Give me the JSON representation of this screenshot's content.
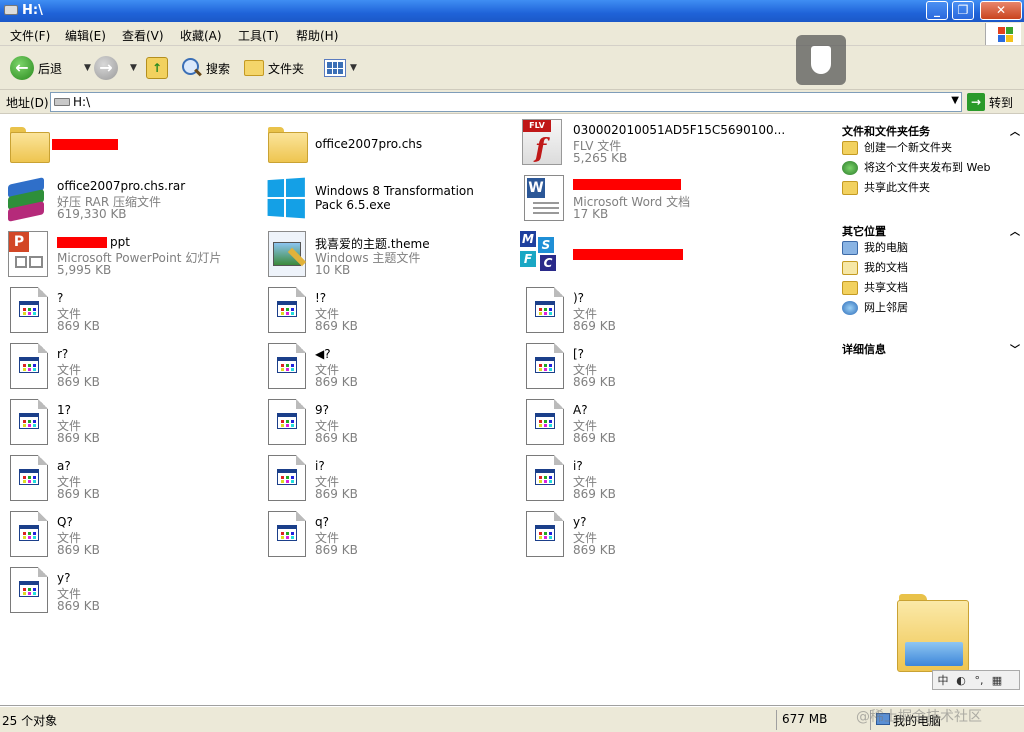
{
  "window": {
    "title": "H:\\"
  },
  "menu": [
    "文件(F)",
    "编辑(E)",
    "查看(V)",
    "收藏(A)",
    "工具(T)",
    "帮助(H)"
  ],
  "toolbar": {
    "back_label": "后退",
    "search_label": "搜索",
    "folders_label": "文件夹"
  },
  "address": {
    "label": "地址(D)",
    "value": "H:\\",
    "go_label": "转到"
  },
  "files": [
    {
      "name": "",
      "type": "",
      "size": "",
      "icon": "folder-icon",
      "redacted": true
    },
    {
      "name": "office2007pro.chs",
      "type": "",
      "size": "",
      "icon": "folder-icon"
    },
    {
      "name": "030002010051AD5F15C5690100...",
      "type": "FLV 文件",
      "size": "5,265 KB",
      "icon": "flv-icon"
    },
    {
      "name": "office2007pro.chs.rar",
      "type": "好压 RAR 压缩文件",
      "size": "619,330 KB",
      "icon": "rar-icon"
    },
    {
      "name": "Windows 8 Transformation Pack 6.5.exe",
      "type": "",
      "size": "",
      "icon": "windows8-icon"
    },
    {
      "name": "",
      "type": "Microsoft Word 文档",
      "size": "17 KB",
      "icon": "word-document-icon",
      "redacted": true
    },
    {
      "name": "ppt",
      "type": "Microsoft PowerPoint 幻灯片",
      "size": "5,995 KB",
      "icon": "powerpoint-icon",
      "redacted": true
    },
    {
      "name": "我喜爱的主题.theme",
      "type": "Windows 主题文件",
      "size": "10 KB",
      "icon": "theme-icon"
    },
    {
      "name": "",
      "type": "",
      "size": "",
      "icon": "msc-icon",
      "redacted": true
    },
    {
      "name": "?",
      "type": "文件",
      "size": "869 KB",
      "icon": "generic-file-icon"
    },
    {
      "name": "!?",
      "type": "文件",
      "size": "869 KB",
      "icon": "generic-file-icon"
    },
    {
      "name": ")?",
      "type": "文件",
      "size": "869 KB",
      "icon": "generic-file-icon"
    },
    {
      "name": "r?",
      "type": "文件",
      "size": "869 KB",
      "icon": "generic-file-icon"
    },
    {
      "name": "◀?",
      "type": "文件",
      "size": "869 KB",
      "icon": "generic-file-icon"
    },
    {
      "name": "[?",
      "type": "文件",
      "size": "869 KB",
      "icon": "generic-file-icon"
    },
    {
      "name": "1?",
      "type": "文件",
      "size": "869 KB",
      "icon": "generic-file-icon"
    },
    {
      "name": "9?",
      "type": "文件",
      "size": "869 KB",
      "icon": "generic-file-icon"
    },
    {
      "name": "A?",
      "type": "文件",
      "size": "869 KB",
      "icon": "generic-file-icon"
    },
    {
      "name": "a?",
      "type": "文件",
      "size": "869 KB",
      "icon": "generic-file-icon"
    },
    {
      "name": "i?",
      "type": "文件",
      "size": "869 KB",
      "icon": "generic-file-icon"
    },
    {
      "name": "i?",
      "type": "文件",
      "size": "869 KB",
      "icon": "generic-file-icon"
    },
    {
      "name": "Q?",
      "type": "文件",
      "size": "869 KB",
      "icon": "generic-file-icon"
    },
    {
      "name": "q?",
      "type": "文件",
      "size": "869 KB",
      "icon": "generic-file-icon"
    },
    {
      "name": "y?",
      "type": "文件",
      "size": "869 KB",
      "icon": "generic-file-icon"
    },
    {
      "name": "y?",
      "type": "文件",
      "size": "869 KB",
      "icon": "generic-file-icon"
    }
  ],
  "taskpane": {
    "tasks": {
      "title": "文件和文件夹任务",
      "items": [
        "创建一个新文件夹",
        "将这个文件夹发布到 Web",
        "共享此文件夹"
      ]
    },
    "places": {
      "title": "其它位置",
      "items": [
        "我的电脑",
        "我的文档",
        "共享文档",
        "网上邻居"
      ]
    },
    "details": {
      "title": "详细信息"
    }
  },
  "ime": [
    "中",
    "◐",
    "°,",
    "▦"
  ],
  "status": {
    "count": "25 个对象",
    "size": "677 MB",
    "location": "我的电脑"
  },
  "watermark": "@稀土掘金技术社区",
  "colors": {
    "titlebar": "#2a6ce0",
    "redaction": "#ff0000",
    "chrome": "#ece9d8"
  }
}
